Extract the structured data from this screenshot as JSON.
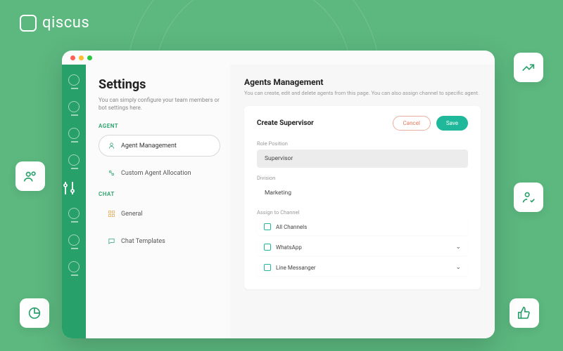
{
  "brand": {
    "name": "qiscus"
  },
  "settings": {
    "title": "Settings",
    "subtitle": "You can simply configure your team members or bot settings here.",
    "sections": {
      "agent": {
        "label": "AGENT",
        "items": [
          "Agent Management",
          "Custom Agent Allocation"
        ]
      },
      "chat": {
        "label": "CHAT",
        "items": [
          "General",
          "Chat Templates"
        ]
      }
    }
  },
  "main": {
    "title": "Agents Management",
    "subtitle": "You can create, edit and delete agents from this page. You can also assign channel to specific agent.",
    "card": {
      "title": "Create Supervisor",
      "cancel": "Cancel",
      "save": "Save",
      "role_label": "Role Position",
      "role_value": "Supervisor",
      "division_label": "Division",
      "division_value": "Marketing",
      "assign_label": "Assign to Channel",
      "channels": [
        "All Channels",
        "WhatsApp",
        "Line Messanger"
      ]
    }
  }
}
